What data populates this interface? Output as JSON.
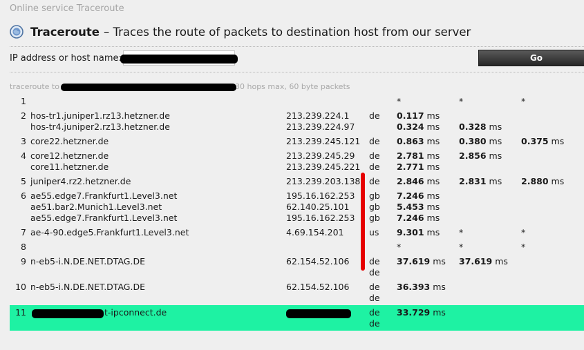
{
  "breadcrumb": "Online service Traceroute",
  "header": {
    "title": "Traceroute",
    "subtitle": "– Traces the route of packets to destination host from our server"
  },
  "form": {
    "label": "IP address or host name:",
    "host_value": "",
    "go_label": "Go"
  },
  "command": {
    "prefix": "traceroute to",
    "suffix": "30 hops max, 60 byte packets"
  },
  "hops": [
    {
      "no": "1",
      "hosts": [
        ""
      ],
      "ips": [
        ""
      ],
      "cc": [
        ""
      ],
      "t1": "*",
      "t1u": "",
      "t2": "*",
      "t2u": "",
      "t3": "*",
      "t3u": ""
    },
    {
      "no": "2",
      "hosts": [
        "hos-tr1.juniper1.rz13.hetzner.de",
        "hos-tr4.juniper2.rz13.hetzner.de"
      ],
      "ips": [
        "213.239.224.1",
        "213.239.224.97"
      ],
      "cc": [
        "de",
        ""
      ],
      "times": [
        [
          "0.117 ms",
          "",
          ""
        ],
        [
          "0.324 ms",
          "0.328 ms",
          ""
        ]
      ]
    },
    {
      "no": "3",
      "hosts": [
        "core22.hetzner.de"
      ],
      "ips": [
        "213.239.245.121"
      ],
      "cc": [
        "de"
      ],
      "times": [
        [
          "0.863 ms",
          "0.380 ms",
          "0.375 ms"
        ]
      ]
    },
    {
      "no": "4",
      "hosts": [
        "core12.hetzner.de",
        "core11.hetzner.de"
      ],
      "ips": [
        "213.239.245.29",
        "213.239.245.221"
      ],
      "cc": [
        "de",
        "de"
      ],
      "times": [
        [
          "2.781 ms",
          "2.856 ms",
          ""
        ],
        [
          "2.771 ms",
          "",
          ""
        ]
      ]
    },
    {
      "no": "5",
      "hosts": [
        "juniper4.rz2.hetzner.de"
      ],
      "ips": [
        "213.239.203.138"
      ],
      "cc": [
        "de"
      ],
      "times": [
        [
          "2.846 ms",
          "2.831 ms",
          "2.880 ms"
        ]
      ]
    },
    {
      "no": "6",
      "hosts": [
        "ae55.edge7.Frankfurt1.Level3.net",
        "ae51.bar2.Munich1.Level3.net",
        "ae55.edge7.Frankfurt1.Level3.net"
      ],
      "ips": [
        "195.16.162.253",
        "62.140.25.101",
        "195.16.162.253"
      ],
      "cc": [
        "gb",
        "gb",
        "gb"
      ],
      "times": [
        [
          "7.246 ms",
          "",
          ""
        ],
        [
          "5.453 ms",
          "",
          ""
        ],
        [
          "7.246 ms",
          "",
          ""
        ]
      ]
    },
    {
      "no": "7",
      "hosts": [
        "ae-4-90.edge5.Frankfurt1.Level3.net"
      ],
      "ips": [
        "4.69.154.201"
      ],
      "cc": [
        "us"
      ],
      "times": [
        [
          "9.301 ms",
          "*",
          "*"
        ]
      ]
    },
    {
      "no": "8",
      "hosts": [
        ""
      ],
      "ips": [
        ""
      ],
      "cc": [
        ""
      ],
      "times": [
        [
          "*",
          "*",
          "*"
        ]
      ]
    },
    {
      "no": "9",
      "hosts": [
        "n-eb5-i.N.DE.NET.DTAG.DE"
      ],
      "ips": [
        "62.154.52.106"
      ],
      "cc": [
        "de",
        "de"
      ],
      "times": [
        [
          "37.619 ms",
          "37.619 ms",
          ""
        ]
      ]
    },
    {
      "no": "10",
      "hosts": [
        "n-eb5-i.N.DE.NET.DTAG.DE"
      ],
      "ips": [
        "62.154.52.106"
      ],
      "cc": [
        "de",
        "de"
      ],
      "times": [
        [
          "36.393 ms",
          "",
          ""
        ]
      ]
    },
    {
      "no": "11",
      "hosts": [
        "t-ipconnect.de"
      ],
      "ips": [
        ""
      ],
      "cc": [
        "de",
        "de"
      ],
      "times": [
        [
          "33.729 ms",
          "",
          ""
        ]
      ],
      "highlight": true
    }
  ],
  "colors": {
    "highlight": "#1ef2a3",
    "annotation": "#e60000"
  }
}
